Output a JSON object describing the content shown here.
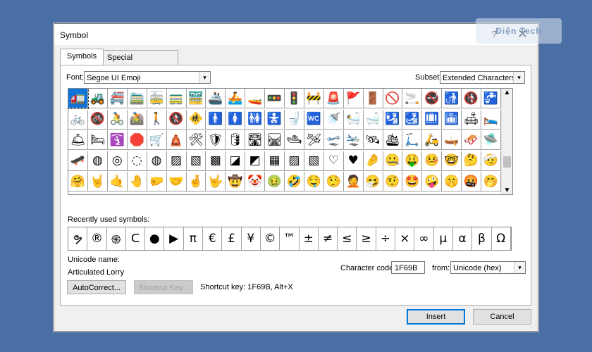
{
  "window": {
    "title": "Symbol",
    "help": "?",
    "close": "✕"
  },
  "watermark": "Điện Tech",
  "tabs": [
    {
      "label": "Symbols"
    },
    {
      "label": "Special Characters"
    }
  ],
  "font": {
    "label": "Font:",
    "value": "Segoe UI Emoji"
  },
  "subset": {
    "label": "Subset:",
    "value": "Extended Characters - P"
  },
  "symbols_grid": [
    [
      "🚛",
      "🚜",
      "🚝",
      "🚞",
      "🚋",
      "🚃",
      "🚟",
      "🚢",
      "🚣",
      "🚤",
      "🚥",
      "🚦",
      "🚧",
      "🚨",
      "🚩",
      "🚪",
      "🚫",
      "🚬",
      "🚭",
      "🚮",
      "🚯",
      "🚰"
    ],
    [
      "🚲",
      "🚳",
      "🚴",
      "🚵",
      "🚶",
      "🚷",
      "🚸",
      "🚹",
      "🚺",
      "🚻",
      "🚼",
      "🚽",
      "🚾",
      "🚿",
      "🛀",
      "🛁",
      "🛂",
      "🛃",
      "🛄",
      "🛅",
      "🛋",
      "🛌"
    ],
    [
      "🛎",
      "🛏",
      "🛐",
      "🛑",
      "🛒",
      "🛕",
      "🛠",
      "🛡",
      "🛢",
      "🛣",
      "🛤",
      "🛥",
      "🛩",
      "🛫",
      "🛬",
      "🛰",
      "🛳",
      "🛴",
      "🛵",
      "🛶",
      "🛷",
      "🛸"
    ],
    [
      "🛹",
      "◍",
      "◎",
      "◌",
      "◍",
      "▨",
      "▧",
      "▩",
      "◪",
      "◩",
      "▦",
      "▨",
      "▧",
      "♡",
      "♥",
      "🤌",
      "🤐",
      "🤑",
      "🤒",
      "🤓",
      "🤔",
      "🤕"
    ],
    [
      "🤗",
      "🤘",
      "🤙",
      "🤚",
      "🤛",
      "🤝",
      "🤞",
      "🤟",
      "🤠",
      "🤡",
      "🤢",
      "🤣",
      "🤤",
      "🤥",
      "🤦",
      "🤧",
      "🤨",
      "🤩",
      "🤪",
      "🤫",
      "🤬",
      "🤭"
    ]
  ],
  "recent": {
    "label": "Recently used symbols:",
    "items": [
      "ຯ",
      "®",
      "֍",
      "ᑕ",
      "●",
      "▶",
      "π",
      "€",
      "£",
      "¥",
      "©",
      "™",
      "±",
      "≠",
      "≤",
      "≥",
      "÷",
      "×",
      "∞",
      "µ",
      "α",
      "β",
      "Ω"
    ]
  },
  "unicode_name": {
    "label": "Unicode name:",
    "value": "Articulated Lorry"
  },
  "char_code": {
    "label": "Character code:",
    "value": "1F69B"
  },
  "from": {
    "label": "from:",
    "value": "Unicode (hex)"
  },
  "buttons": {
    "autocorrect": "AutoCorrect...",
    "shortcut_key": "Shortcut Key...",
    "insert": "Insert",
    "cancel": "Cancel"
  },
  "shortcut_text": "Shortcut key: 1F69B, Alt+X"
}
